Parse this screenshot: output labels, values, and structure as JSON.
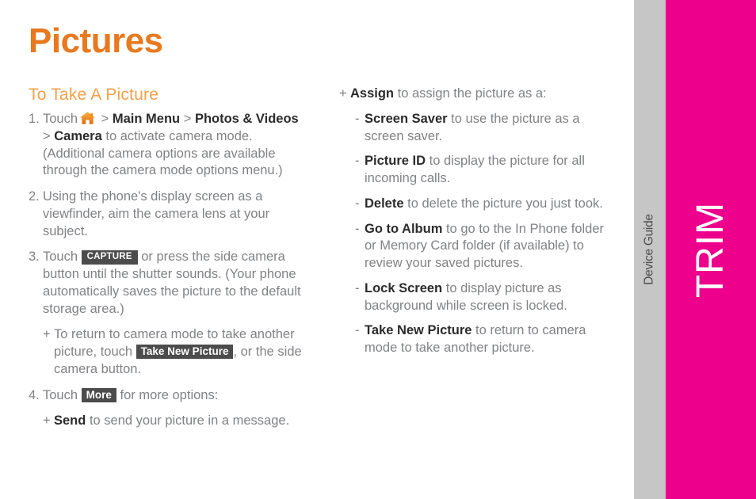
{
  "page": {
    "title": "Pictures",
    "section_title": "To Take A Picture",
    "accent_title_color": "#e8791e",
    "accent_section_color": "#f5a04a",
    "body_text_color": "#808285",
    "badge_color": "#4c4c4c"
  },
  "edge": {
    "guide_label": "Device Guide",
    "trim_label": "TRIM",
    "gray_color": "#c6c6c6",
    "magenta_color": "#ec008c"
  },
  "icons": {
    "home": "home-icon"
  },
  "badges": {
    "capture": "CAPTURE",
    "take_new_picture": "Take New Picture",
    "more": "More"
  },
  "left_column": {
    "steps": [
      {
        "number": "1.",
        "parts": {
          "touch": "Touch",
          "sep": ">",
          "main_menu": "Main Menu",
          "photos_videos": "Photos & Videos",
          "camera": "Camera",
          "tail": "to activate camera mode. (Additional camera options are available through the camera mode options menu.)"
        }
      },
      {
        "number": "2.",
        "text": "Using the phone's display screen as a viewfinder, aim the camera lens at your subject."
      },
      {
        "number": "3.",
        "parts": {
          "lead": "Touch",
          "tail": "or press the side camera button until the shutter sounds. (Your phone automatically saves the picture to the default storage area.)"
        },
        "sub": [
          {
            "mark": "+",
            "parts": {
              "lead": "To return to camera mode to take another picture, touch",
              "tail": ", or the side camera button."
            }
          }
        ]
      },
      {
        "number": "4.",
        "parts": {
          "lead": "Touch",
          "tail": "for more options:"
        },
        "sub": [
          {
            "mark": "+",
            "bold": "Send",
            "text": "to send your picture in a message."
          }
        ]
      }
    ]
  },
  "right_column": {
    "plus_item": {
      "mark": "+",
      "bold": "Assign",
      "text": "to assign the picture as a:"
    },
    "dash_items": [
      {
        "mark": "-",
        "bold": "Screen Saver",
        "text": "to use the picture as a screen saver."
      },
      {
        "mark": "-",
        "bold": "Picture ID",
        "text": "to display the picture for all incoming calls."
      },
      {
        "mark": "-",
        "bold": "Delete",
        "text": "to delete the picture you just took."
      },
      {
        "mark": "-",
        "bold": "Go to Album",
        "text": "to go to the In Phone folder or Memory Card folder (if available) to review your saved pictures."
      },
      {
        "mark": "-",
        "bold": "Lock Screen",
        "text": "to display picture as background while screen is locked."
      },
      {
        "mark": "-",
        "bold": "Take New Picture",
        "text": "to return to camera mode to take another picture."
      }
    ]
  }
}
